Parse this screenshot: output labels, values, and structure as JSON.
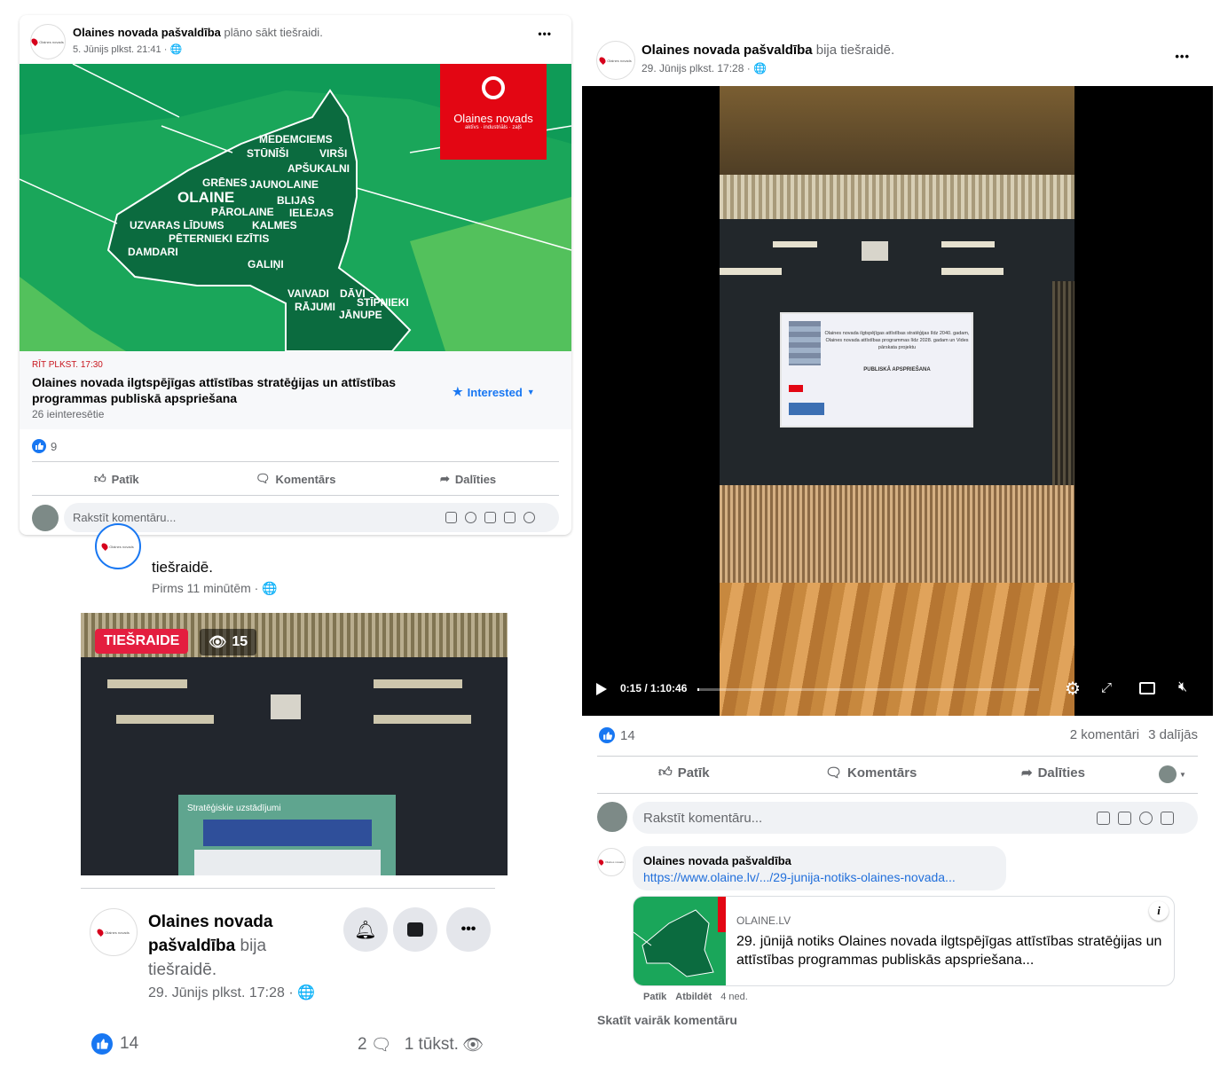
{
  "post_event": {
    "author": "Olaines novada pašvaldība",
    "action_text": "plāno sākt tiešraidi.",
    "date": "5. Jūnijs plkst. 21:41 ·",
    "menu": "•••",
    "map": {
      "logo_title": "Olaines novads",
      "logo_sub": "aktīvs · industriāls · zaļš",
      "labels": [
        "MEDEMCIEMS",
        "STŪNĪŠI",
        "VIRŠI",
        "APŠUKALNI",
        "GRĒNES",
        "JAUNOLAINE",
        "OLAINE",
        "BLIJAS",
        "PĀROLAINE",
        "IELEJAS",
        "UZVARAS LĪDUMS",
        "KALMES",
        "PĒTERNIEKI",
        "EZĪTIS",
        "DAMDARI",
        "GALIŅI",
        "VAIVADI",
        "DĀVI",
        "RĀJUMI",
        "STĪPNIEKI",
        "JĀNUPE"
      ]
    },
    "event_time": "RĪT PLKST. 17:30",
    "event_title": "Olaines novada ilgtspējīgas attīstības stratēģijas un attīstības programmas publiskā apspriešana",
    "interested_count": "26 ieinteresētie",
    "interested_button": "Interested",
    "likes": "9",
    "like_label": "Patīk",
    "comment_label": "Komentārs",
    "share_label": "Dalīties",
    "comment_placeholder": "Rakstīt komentāru..."
  },
  "post_live": {
    "author": "Olaines novada pašvaldība",
    "action_text": "bija tiešraidē.",
    "date": "29. Jūnijs plkst. 17:28 ·",
    "menu": "•••",
    "video_time": "0:15 / 1:10:46",
    "video_progress": 0.004,
    "slide_title": "Olaines novada ilgtspējīgas attīstības stratēģijas līdz 2040. gadam, Olaines novada attīstības programmas līdz 2028. gadam un Vides pārskata projektu",
    "slide_subtitle": "PUBLISKĀ APSPRIEŠANA",
    "likes": "14",
    "comments_count": "2 komentāri",
    "shares_count": "3 dalījās",
    "like_label": "Patīk",
    "comment_label": "Komentārs",
    "share_label": "Dalīties",
    "comment_placeholder": "Rakstīt komentāru...",
    "comment": {
      "author": "Olaines novada pašvaldība",
      "link": "https://www.olaine.lv/.../29-junija-notiks-olaines-novada...",
      "preview_domain": "OLAINE.LV",
      "preview_title": "29. jūnijā notiks Olaines novada ilgtspējīgas attīstības stratēģijas un attīstības programmas publiskās apspriešana...",
      "like": "Patīk",
      "reply": "Atbildēt",
      "age": "4 ned."
    },
    "more_comments": "Skatīt vairāk komentāru"
  },
  "post_mobile": {
    "header_text": "tiešraidē.",
    "header_date": "Pirms 11 minūtēm ·",
    "live_badge": "TIEŠRAIDE",
    "viewers": "15",
    "slide_title": "Stratēģiskie uzstādījumi",
    "author": "Olaines novada pašvaldība",
    "action_text": "bija tiešraidē.",
    "date": "29. Jūnijs plkst. 17:28 ·",
    "likes": "14",
    "comments": "2",
    "views": "1 tūkst."
  },
  "colors": {
    "brand_blue": "#1877f2",
    "live_red": "#e41e3f",
    "map_dark_green": "#0b6b3f",
    "map_green": "#1aa65a",
    "logo_red": "#e30613"
  }
}
